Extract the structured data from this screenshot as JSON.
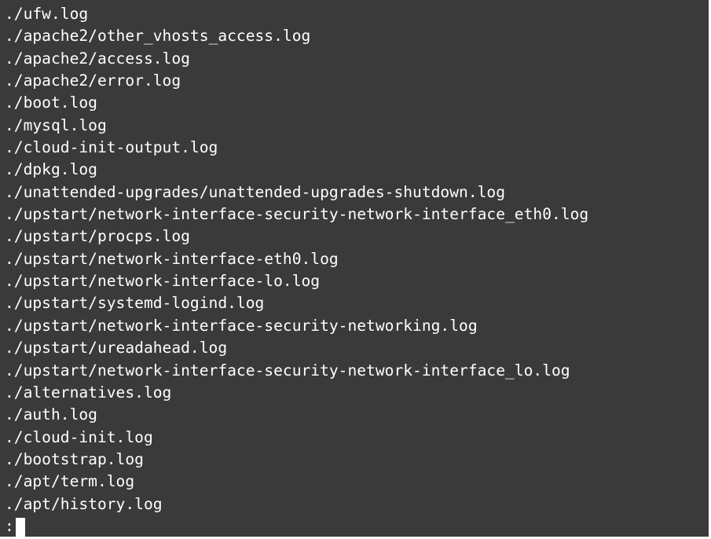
{
  "terminal": {
    "lines": [
      "./ufw.log",
      "./apache2/other_vhosts_access.log",
      "./apache2/access.log",
      "./apache2/error.log",
      "./boot.log",
      "./mysql.log",
      "./cloud-init-output.log",
      "./dpkg.log",
      "./unattended-upgrades/unattended-upgrades-shutdown.log",
      "./upstart/network-interface-security-network-interface_eth0.log",
      "./upstart/procps.log",
      "./upstart/network-interface-eth0.log",
      "./upstart/network-interface-lo.log",
      "./upstart/systemd-logind.log",
      "./upstart/network-interface-security-networking.log",
      "./upstart/ureadahead.log",
      "./upstart/network-interface-security-network-interface_lo.log",
      "./alternatives.log",
      "./auth.log",
      "./cloud-init.log",
      "./bootstrap.log",
      "./apt/term.log",
      "./apt/history.log"
    ],
    "prompt": ":",
    "background_color": "#3a3a3a",
    "text_color": "#ffffff"
  }
}
